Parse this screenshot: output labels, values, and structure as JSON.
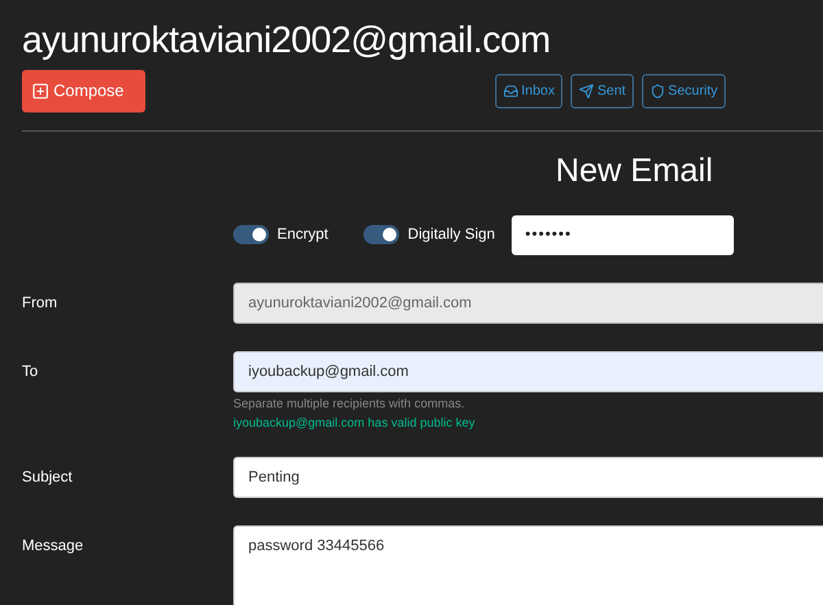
{
  "account": {
    "title": "ayunuroktaviani2002@gmail.com"
  },
  "compose_button": {
    "label": "Compose"
  },
  "nav_buttons": [
    {
      "label": "Inbox",
      "kind": "inbox"
    },
    {
      "label": "Sent",
      "kind": "sent"
    },
    {
      "label": "Security",
      "kind": "security"
    }
  ],
  "form": {
    "heading": "New Email",
    "toggles": [
      {
        "label": "Encrypt",
        "on": true
      },
      {
        "label": "Digitally Sign",
        "on": true
      }
    ],
    "passphrase": {
      "value": "•••••••"
    },
    "fields": [
      {
        "label": "From",
        "value": "ayunuroktaviani2002@gmail.com",
        "disabled": true,
        "autofilled": false,
        "kind": "input"
      },
      {
        "label": "To",
        "value": "iyoubackup@gmail.com",
        "disabled": false,
        "autofilled": true,
        "kind": "input",
        "hint": "Separate multiple recipients with commas.",
        "status": "iyoubackup@gmail.com has valid public key"
      },
      {
        "label": "Subject",
        "value": "Penting",
        "disabled": false,
        "autofilled": false,
        "kind": "input"
      },
      {
        "label": "Message",
        "value": "password 33445566",
        "disabled": false,
        "autofilled": false,
        "kind": "textarea"
      }
    ]
  }
}
